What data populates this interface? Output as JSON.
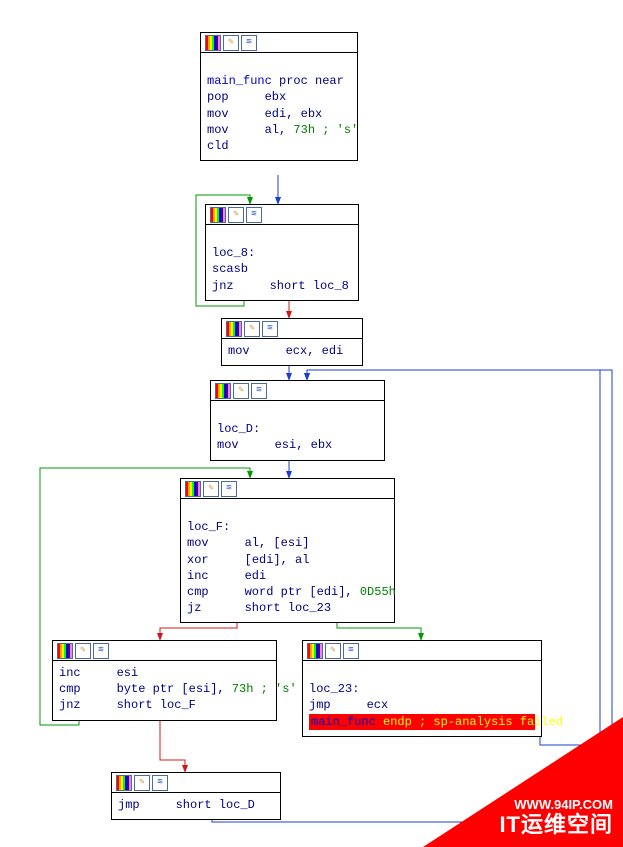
{
  "nodes": {
    "n1": {
      "lines": [
        [
          {
            "t": " ",
            "c": ""
          }
        ],
        [
          {
            "t": "main_func",
            "c": "blue"
          },
          {
            "t": " proc near",
            "c": "dark"
          }
        ],
        [
          {
            "t": "pop     ",
            "c": "dark"
          },
          {
            "t": "ebx",
            "c": "dark"
          }
        ],
        [
          {
            "t": "mov     ",
            "c": "dark"
          },
          {
            "t": "edi",
            "c": "dark"
          },
          {
            "t": ", ",
            "c": "dark"
          },
          {
            "t": "ebx",
            "c": "dark"
          }
        ],
        [
          {
            "t": "mov     ",
            "c": "dark"
          },
          {
            "t": "al",
            "c": "dark"
          },
          {
            "t": ", ",
            "c": "dark"
          },
          {
            "t": "73h",
            "c": "greenm"
          },
          {
            "t": " ; 's'",
            "c": "green"
          }
        ],
        [
          {
            "t": "cld",
            "c": "dark"
          }
        ]
      ]
    },
    "n2": {
      "lines": [
        [
          {
            "t": " ",
            "c": ""
          }
        ],
        [
          {
            "t": "loc_8:",
            "c": "dark"
          }
        ],
        [
          {
            "t": "scasb",
            "c": "dark"
          }
        ],
        [
          {
            "t": "jnz     ",
            "c": "dark"
          },
          {
            "t": "short loc_8",
            "c": "dark"
          }
        ]
      ]
    },
    "n3": {
      "lines": [
        [
          {
            "t": "mov     ",
            "c": "dark"
          },
          {
            "t": "ecx",
            "c": "dark"
          },
          {
            "t": ", ",
            "c": "dark"
          },
          {
            "t": "edi",
            "c": "dark"
          }
        ]
      ]
    },
    "n4": {
      "lines": [
        [
          {
            "t": " ",
            "c": ""
          }
        ],
        [
          {
            "t": "loc_D:",
            "c": "dark"
          }
        ],
        [
          {
            "t": "mov     ",
            "c": "dark"
          },
          {
            "t": "esi",
            "c": "dark"
          },
          {
            "t": ", ",
            "c": "dark"
          },
          {
            "t": "ebx",
            "c": "dark"
          }
        ]
      ]
    },
    "n5": {
      "lines": [
        [
          {
            "t": " ",
            "c": ""
          }
        ],
        [
          {
            "t": "loc_F:",
            "c": "dark"
          }
        ],
        [
          {
            "t": "mov     ",
            "c": "dark"
          },
          {
            "t": "al",
            "c": "dark"
          },
          {
            "t": ", [",
            "c": "dark"
          },
          {
            "t": "esi",
            "c": "dark"
          },
          {
            "t": "]",
            "c": "dark"
          }
        ],
        [
          {
            "t": "xor     [",
            "c": "dark"
          },
          {
            "t": "edi",
            "c": "dark"
          },
          {
            "t": "], ",
            "c": "dark"
          },
          {
            "t": "al",
            "c": "dark"
          }
        ],
        [
          {
            "t": "inc     ",
            "c": "dark"
          },
          {
            "t": "edi",
            "c": "dark"
          }
        ],
        [
          {
            "t": "cmp     ",
            "c": "dark"
          },
          {
            "t": "word ptr",
            "c": "dark"
          },
          {
            "t": " [",
            "c": "dark"
          },
          {
            "t": "edi",
            "c": "dark"
          },
          {
            "t": "], ",
            "c": "dark"
          },
          {
            "t": "0D55h",
            "c": "greenm"
          }
        ],
        [
          {
            "t": "jz      ",
            "c": "dark"
          },
          {
            "t": "short loc_23",
            "c": "dark"
          }
        ]
      ]
    },
    "n6": {
      "lines": [
        [
          {
            "t": "inc     ",
            "c": "dark"
          },
          {
            "t": "esi",
            "c": "dark"
          }
        ],
        [
          {
            "t": "cmp     ",
            "c": "dark"
          },
          {
            "t": "byte ptr",
            "c": "dark"
          },
          {
            "t": " [",
            "c": "dark"
          },
          {
            "t": "esi",
            "c": "dark"
          },
          {
            "t": "], ",
            "c": "dark"
          },
          {
            "t": "73h",
            "c": "greenm"
          },
          {
            "t": " ; 's'",
            "c": "green"
          }
        ],
        [
          {
            "t": "jnz     ",
            "c": "dark"
          },
          {
            "t": "short loc_F",
            "c": "dark"
          }
        ]
      ]
    },
    "n7": {
      "lines": [
        [
          {
            "t": " ",
            "c": ""
          }
        ],
        [
          {
            "t": "loc_23:",
            "c": "dark"
          }
        ],
        [
          {
            "t": "jmp     ",
            "c": "dark"
          },
          {
            "t": "ecx",
            "c": "dark"
          }
        ],
        [
          {
            "t": "main_func",
            "c": "blue"
          },
          {
            "t": " endp ; sp-analysis failed",
            "c": "err"
          }
        ]
      ]
    },
    "n8": {
      "lines": [
        [
          {
            "t": "jmp     ",
            "c": "dark"
          },
          {
            "t": "short loc_D",
            "c": "dark"
          }
        ]
      ]
    }
  },
  "watermark": {
    "url": "WWW.94IP.COM",
    "brand": "IT运维空间"
  }
}
